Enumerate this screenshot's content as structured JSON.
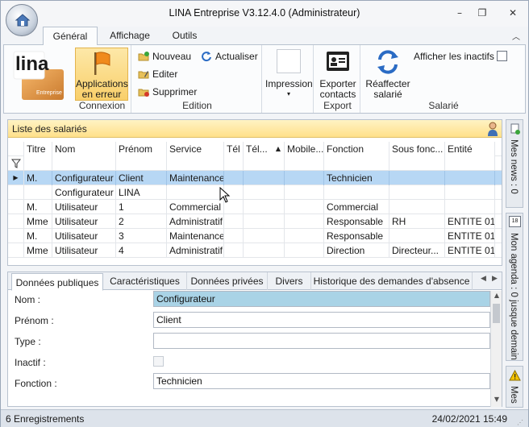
{
  "window": {
    "title": "LINA Entreprise  V3.12.4.0  (Administrateur)",
    "controls": [
      "–",
      "❐",
      "✕"
    ]
  },
  "ribbon_tabs": [
    "Général",
    "Affichage",
    "Outils"
  ],
  "ribbon": {
    "logo_text": "lina",
    "logo_sub": "Entreprise",
    "connexion": {
      "button_line1": "Applications",
      "button_line2": "en erreur",
      "label": "Connexion"
    },
    "edition": {
      "nouveau": "Nouveau",
      "actualiser": "Actualiser",
      "editer": "Editer",
      "supprimer": "Supprimer",
      "label": "Edition"
    },
    "impression": {
      "button": "Impression"
    },
    "export": {
      "button_line1": "Exporter",
      "button_line2": "contacts",
      "label": "Export"
    },
    "salarie": {
      "button_line1": "Réaffecter",
      "button_line2": "salarié",
      "show_inactive": "Afficher les inactifs",
      "label": "Salarié"
    }
  },
  "list": {
    "title": "Liste des salariés",
    "columns": [
      "Titre",
      "Nom",
      "Prénom",
      "Service",
      "Tél",
      "Tél...",
      "Mobile...",
      "Fonction",
      "Sous fonc...",
      "Entité"
    ],
    "rows": [
      [
        "M.",
        "Configurateur",
        "Client",
        "Maintenance",
        "",
        "",
        "",
        "Technicien",
        "",
        ""
      ],
      [
        "",
        "Configurateur",
        "LINA",
        "",
        "",
        "",
        "",
        "",
        "",
        ""
      ],
      [
        "M.",
        "Utilisateur",
        "1",
        "Commercial",
        "",
        "",
        "",
        "Commercial",
        "",
        ""
      ],
      [
        "Mme",
        "Utilisateur",
        "2",
        "Administratif",
        "",
        "",
        "",
        "Responsable",
        "RH",
        "ENTITE 01"
      ],
      [
        "M.",
        "Utilisateur",
        "3",
        "Maintenance",
        "",
        "",
        "",
        "Responsable",
        "",
        "ENTITE 01"
      ],
      [
        "Mme",
        "Utilisateur",
        "4",
        "Administratif",
        "",
        "",
        "",
        "Direction",
        "Directeur...",
        "ENTITE 01"
      ]
    ]
  },
  "detail": {
    "tabs": [
      "Données publiques",
      "Caractéristiques",
      "Données privées",
      "Divers",
      "Historique des demandes d'absence"
    ],
    "fields": {
      "nom_label": "Nom :",
      "nom_value": "Configurateur",
      "prenom_label": "Prénom :",
      "prenom_value": "Client",
      "type_label": "Type :",
      "type_value": "",
      "inactif_label": "Inactif :",
      "fonction_label": "Fonction :",
      "fonction_value": "Technicien"
    }
  },
  "side_panel": {
    "news": "Mes news : 0",
    "agenda": "Mon agenda : 0 jusque demain",
    "agenda_day": "18",
    "alerts": "Mes"
  },
  "status": {
    "records": "6 Enregistrements",
    "datetime": "24/02/2021 15:49"
  },
  "colors": {
    "selected_row": "#b7d7f4",
    "highlight_button": "#f9cf6a",
    "list_header": "#ffe08a",
    "field_highlight": "#a9d3e6"
  }
}
